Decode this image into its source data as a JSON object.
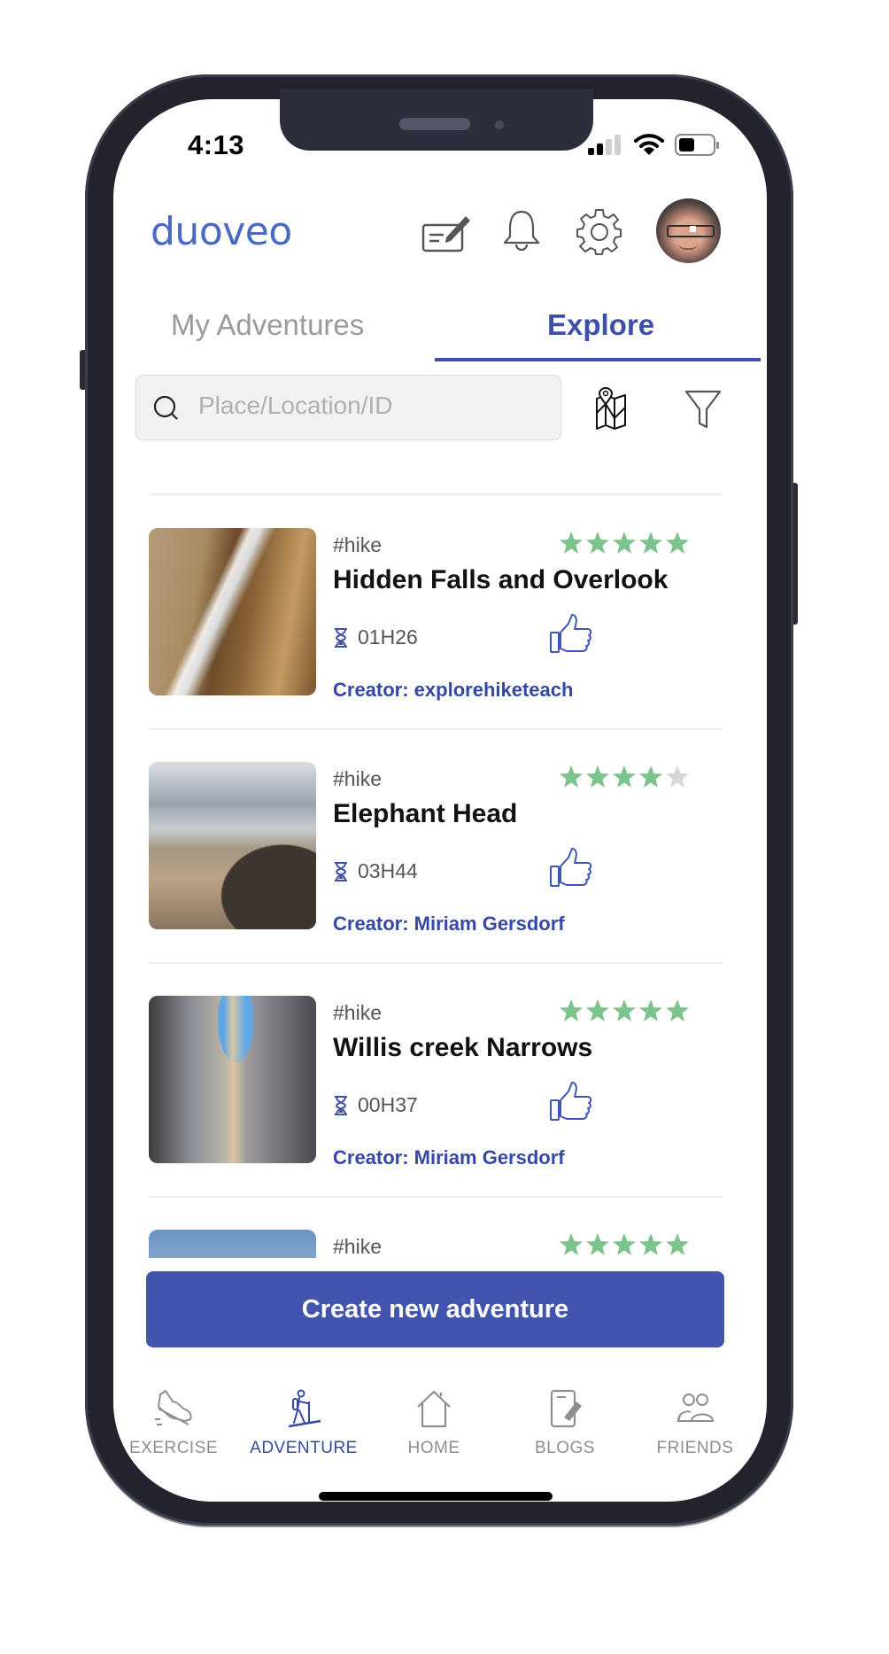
{
  "status_bar": {
    "time": "4:13",
    "signal_icon": "cellular-signal-icon",
    "wifi_icon": "wifi-icon",
    "battery_icon": "battery-icon"
  },
  "header": {
    "logo": "duoveo",
    "icons": [
      "edit-note-icon",
      "bell-icon",
      "gear-icon",
      "avatar"
    ]
  },
  "tabs": [
    {
      "label": "My Adventures",
      "active": false
    },
    {
      "label": "Explore",
      "active": true
    }
  ],
  "search": {
    "placeholder": "Place/Location/ID",
    "value": "",
    "map_icon": "map-icon",
    "filter_icon": "filter-icon"
  },
  "adventures": [
    {
      "tag": "#hike",
      "title": "Hidden Falls and Overlook",
      "rating": 5,
      "max_rating": 5,
      "duration": "01H26",
      "creator": "Creator: explorehiketeach"
    },
    {
      "tag": "#hike",
      "title": "Elephant Head",
      "rating": 4,
      "max_rating": 5,
      "duration": "03H44",
      "creator": "Creator: Miriam Gersdorf"
    },
    {
      "tag": "#hike",
      "title": "Willis creek Narrows",
      "rating": 5,
      "max_rating": 5,
      "duration": "00H37",
      "creator": "Creator: Miriam Gersdorf"
    },
    {
      "tag": "#hike",
      "title": "",
      "rating": 5,
      "max_rating": 5,
      "duration": "",
      "creator": ""
    }
  ],
  "create_button": {
    "label": "Create new adventure"
  },
  "bottom_nav": [
    {
      "label": "EXERCISE",
      "icon": "shoe-icon",
      "active": false
    },
    {
      "label": "ADVENTURE",
      "icon": "hiker-icon",
      "active": true
    },
    {
      "label": "HOME",
      "icon": "home-icon",
      "active": false
    },
    {
      "label": "BLOGS",
      "icon": "blog-icon",
      "active": false
    },
    {
      "label": "FRIENDS",
      "icon": "friends-icon",
      "active": false
    }
  ],
  "colors": {
    "brand": "#4a69c3",
    "accent": "#3d4fa8",
    "button": "#4254ad",
    "star_filled": "#7cc48b",
    "star_empty": "#d6d6d6"
  }
}
